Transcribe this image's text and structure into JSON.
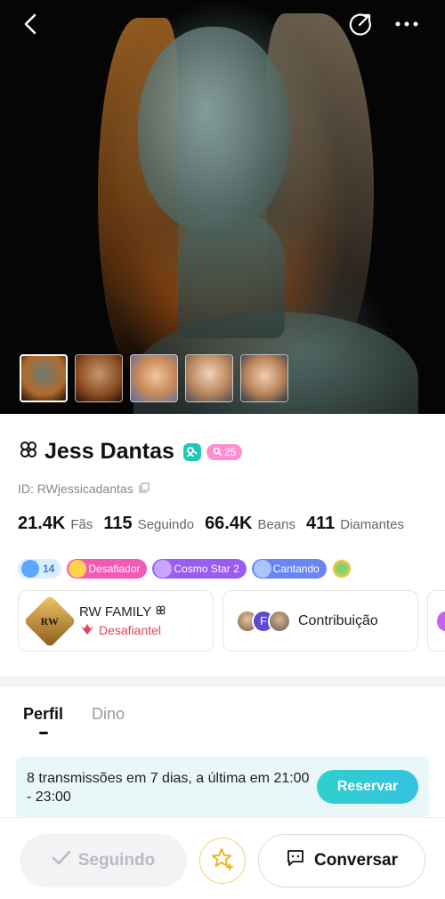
{
  "hero": {
    "icons": {
      "back": "chevron-left-icon",
      "share": "share-arrow-icon",
      "more": "more-dots-icon"
    },
    "thumbnails": [
      "photo-1",
      "photo-2",
      "photo-3",
      "photo-4",
      "photo-5"
    ],
    "selected_thumbnail": 0
  },
  "profile": {
    "name": "Jess Dantas",
    "level": "25",
    "id_text": "ID: RWjessicadantas",
    "stats": [
      {
        "value": "21.4K",
        "label": "Fãs"
      },
      {
        "value": "115",
        "label": "Seguindo"
      },
      {
        "value": "66.4K",
        "label": "Beans"
      },
      {
        "value": "411",
        "label": "Diamantes"
      }
    ],
    "badges": {
      "diamond": "14",
      "challenger": "Desafiador",
      "cosmo": "Cosmo Star 2",
      "singing": "Cantando"
    },
    "family": {
      "logo_text": "RW",
      "name": "RW FAMILY",
      "subtitle": "Desafiantel"
    },
    "contribution": {
      "avatar_letter": "F",
      "label": "Contribuição"
    }
  },
  "tabs": {
    "items": [
      "Perfil",
      "Dino"
    ],
    "active": "Perfil"
  },
  "schedule": {
    "text": "8 transmissões em 7 dias, a última em 21:00 - 23:00",
    "button": "Reservar"
  },
  "bottom": {
    "following": "Seguindo",
    "chat": "Conversar"
  },
  "colors": {
    "accent": "#2fd0cc",
    "level_badge": "#ff8fd1",
    "family_sub": "#e0455b"
  }
}
